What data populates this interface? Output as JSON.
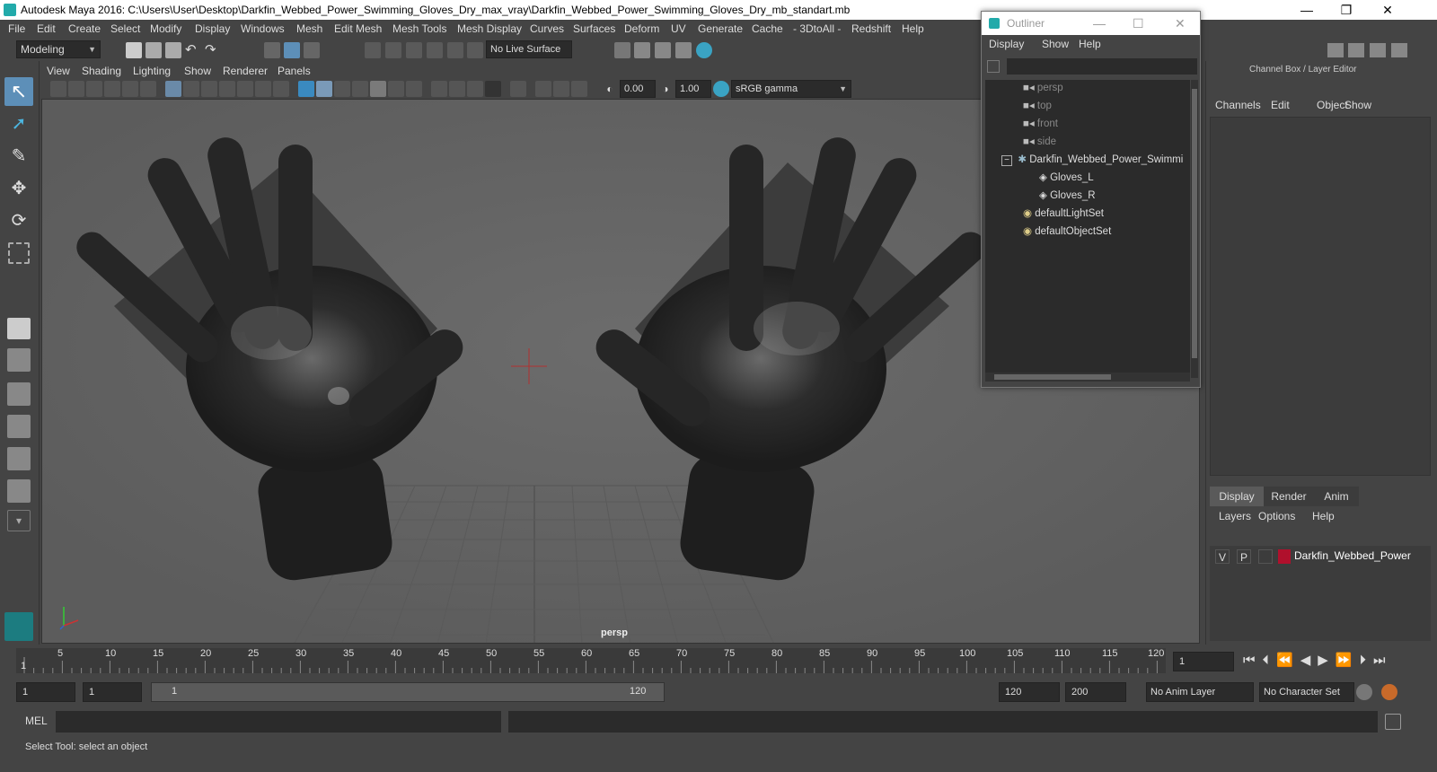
{
  "window": {
    "title": "Autodesk Maya 2016: C:\\Users\\User\\Desktop\\Darkfin_Webbed_Power_Swimming_Gloves_Dry_max_vray\\Darkfin_Webbed_Power_Swimming_Gloves_Dry_mb_standart.mb",
    "controls": {
      "minimize": "—",
      "restore": "❐",
      "close": "✕"
    }
  },
  "menubar": [
    "File",
    "Edit",
    "Create",
    "Select",
    "Modify",
    "Display",
    "Windows",
    "Mesh",
    "Edit Mesh",
    "Mesh Tools",
    "Mesh Display",
    "Curves",
    "Surfaces",
    "Deform",
    "UV",
    "Generate",
    "Cache",
    "- 3DtoAll -",
    "Redshift",
    "Help"
  ],
  "shelf": {
    "mode": "Modeling",
    "live_surface": "No Live Surface"
  },
  "viewport": {
    "menu": [
      "View",
      "Shading",
      "Lighting",
      "Show",
      "Renderer",
      "Panels"
    ],
    "exposure": "0.00",
    "gamma": "1.00",
    "color_space": "sRGB gamma",
    "camera_label": "persp"
  },
  "outliner": {
    "title": "Outliner",
    "menu": [
      "Display",
      "Show",
      "Help"
    ],
    "items": [
      {
        "label": "persp",
        "icon": "camera-icon",
        "dim": true
      },
      {
        "label": "top",
        "icon": "camera-icon",
        "dim": true
      },
      {
        "label": "front",
        "icon": "camera-icon",
        "dim": true
      },
      {
        "label": "side",
        "icon": "camera-icon",
        "dim": true
      },
      {
        "label": "Darkfin_Webbed_Power_Swimmi",
        "icon": "group-icon",
        "dim": false
      },
      {
        "label": "Gloves_L",
        "icon": "mesh-icon",
        "dim": false
      },
      {
        "label": "Gloves_R",
        "icon": "mesh-icon",
        "dim": false
      },
      {
        "label": "defaultLightSet",
        "icon": "set-icon",
        "dim": false
      },
      {
        "label": "defaultObjectSet",
        "icon": "set-icon",
        "dim": false
      }
    ]
  },
  "channelbox": {
    "title": "Channel Box / Layer Editor",
    "menu": [
      "Channels",
      "Edit",
      "Object",
      "Show"
    ],
    "tabs": [
      "Display",
      "Render",
      "Anim"
    ],
    "layer_menu": [
      "Layers",
      "Options",
      "Help"
    ],
    "layer": {
      "v": "V",
      "p": "P",
      "name": "Darkfin_Webbed_Power",
      "color": "#b0102c"
    }
  },
  "timeline": {
    "ticks": [
      "5",
      "10",
      "15",
      "20",
      "25",
      "30",
      "35",
      "40",
      "45",
      "50",
      "55",
      "60",
      "65",
      "70",
      "75",
      "80",
      "85",
      "90",
      "95",
      "100",
      "105",
      "110",
      "115",
      "120"
    ],
    "first": "1",
    "current_frame": "1"
  },
  "range": {
    "start": "1",
    "start2": "1",
    "slider_start": "1",
    "slider_end": "120",
    "end": "120",
    "end2": "200",
    "anim_layer": "No Anim Layer",
    "character_set": "No Character Set"
  },
  "cmdline": {
    "label": "MEL"
  },
  "status": {
    "help": "Select Tool: select an object"
  }
}
